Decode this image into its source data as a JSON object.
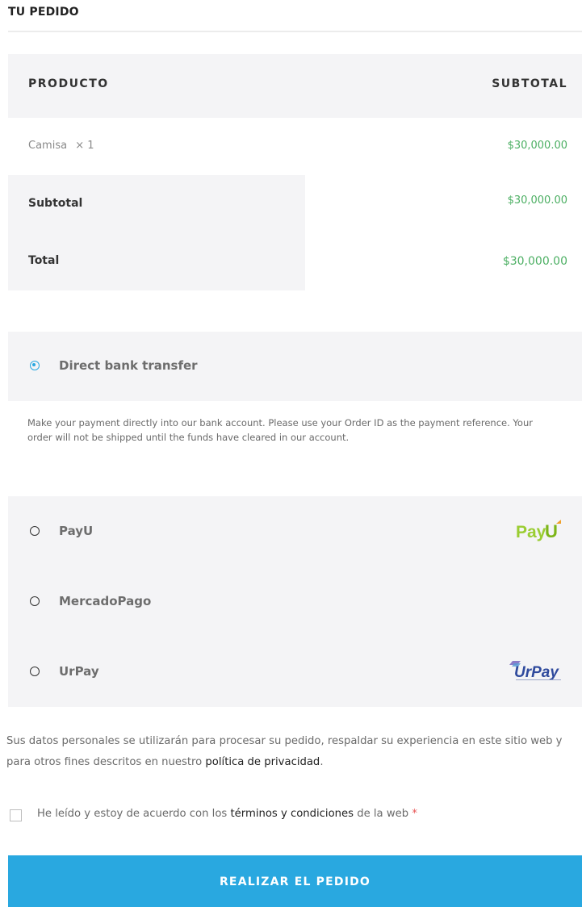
{
  "section": {
    "title": "TU PEDIDO"
  },
  "order": {
    "headers": {
      "product": "PRODUCTO",
      "subtotal": "SUBTOTAL"
    },
    "items": [
      {
        "name": "Camisa",
        "qty": "× 1",
        "price": "$30,000.00"
      }
    ],
    "subtotal": {
      "label": "Subtotal",
      "value": "$30,000.00"
    },
    "total": {
      "label": "Total",
      "value": "$30,000.00"
    }
  },
  "payment": {
    "selected": "Direct bank transfer",
    "methods": [
      {
        "label": "Direct bank transfer",
        "selected": true
      },
      {
        "label": "PayU",
        "logo_text": "PayU",
        "selected": false
      },
      {
        "label": "MercadoPago",
        "selected": false
      },
      {
        "label": "UrPay",
        "logo_text": "UrPay",
        "selected": false
      }
    ],
    "bank_description": "Make your payment directly into our bank account. Please use your Order ID as the payment reference. Your order will not be shipped until the funds have cleared in our account."
  },
  "privacy": {
    "text": "Sus datos personales se utilizarán para procesar su pedido, respaldar su experiencia en este sitio web y para otros fines descritos en nuestro",
    "link": "política de privacidad",
    "end": "."
  },
  "terms": {
    "before": "He leído y estoy de acuerdo con los",
    "link": "términos y condiciones",
    "after": "de la web",
    "required_mark": "*",
    "checked": false
  },
  "button": {
    "label": "REALIZAR EL PEDIDO"
  },
  "colors": {
    "accent": "#29a8e0",
    "price_green": "#4caf63",
    "panel_bg": "#f4f4f6",
    "payu_green": "#9acd32",
    "urpay_blue": "#2f4a9d"
  }
}
